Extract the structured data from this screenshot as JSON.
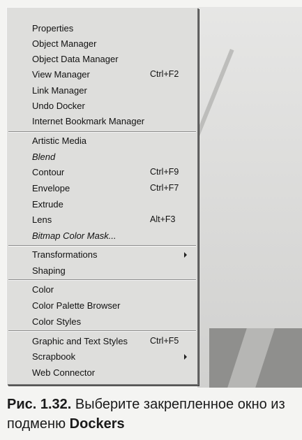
{
  "menu": {
    "items": [
      {
        "label": "Properties",
        "shortcut": "",
        "submenu": false,
        "italic": false
      },
      {
        "label": "Object Manager",
        "shortcut": "",
        "submenu": false,
        "italic": false
      },
      {
        "label": "Object Data Manager",
        "shortcut": "",
        "submenu": false,
        "italic": false
      },
      {
        "label": "View Manager",
        "shortcut": "Ctrl+F2",
        "submenu": false,
        "italic": false
      },
      {
        "label": "Link Manager",
        "shortcut": "",
        "submenu": false,
        "italic": false
      },
      {
        "label": "Undo Docker",
        "shortcut": "",
        "submenu": false,
        "italic": false
      },
      {
        "label": "Internet Bookmark Manager",
        "shortcut": "",
        "submenu": false,
        "italic": false
      },
      {
        "label": "Artistic Media",
        "shortcut": "",
        "submenu": false,
        "italic": false
      },
      {
        "label": "Blend",
        "shortcut": "",
        "submenu": false,
        "italic": true
      },
      {
        "label": "Contour",
        "shortcut": "Ctrl+F9",
        "submenu": false,
        "italic": false
      },
      {
        "label": "Envelope",
        "shortcut": "Ctrl+F7",
        "submenu": false,
        "italic": false
      },
      {
        "label": "Extrude",
        "shortcut": "",
        "submenu": false,
        "italic": false
      },
      {
        "label": "Lens",
        "shortcut": "Alt+F3",
        "submenu": false,
        "italic": false
      },
      {
        "label": "Bitmap Color Mask...",
        "shortcut": "",
        "submenu": false,
        "italic": true
      },
      {
        "label": "Transformations",
        "shortcut": "",
        "submenu": true,
        "italic": false
      },
      {
        "label": "Shaping",
        "shortcut": "",
        "submenu": false,
        "italic": false
      },
      {
        "label": "Color",
        "shortcut": "",
        "submenu": false,
        "italic": false
      },
      {
        "label": "Color Palette Browser",
        "shortcut": "",
        "submenu": false,
        "italic": false
      },
      {
        "label": "Color Styles",
        "shortcut": "",
        "submenu": false,
        "italic": false
      },
      {
        "label": "Graphic and Text Styles",
        "shortcut": "Ctrl+F5",
        "submenu": false,
        "italic": false
      },
      {
        "label": "Scrapbook",
        "shortcut": "",
        "submenu": true,
        "italic": false
      },
      {
        "label": "Web Connector",
        "shortcut": "",
        "submenu": false,
        "italic": false
      }
    ]
  },
  "caption": {
    "number": "Рис. 1.32.",
    "text_part1": " Выберите закрепленное окно из подменю ",
    "strong_word": "Dockers"
  }
}
